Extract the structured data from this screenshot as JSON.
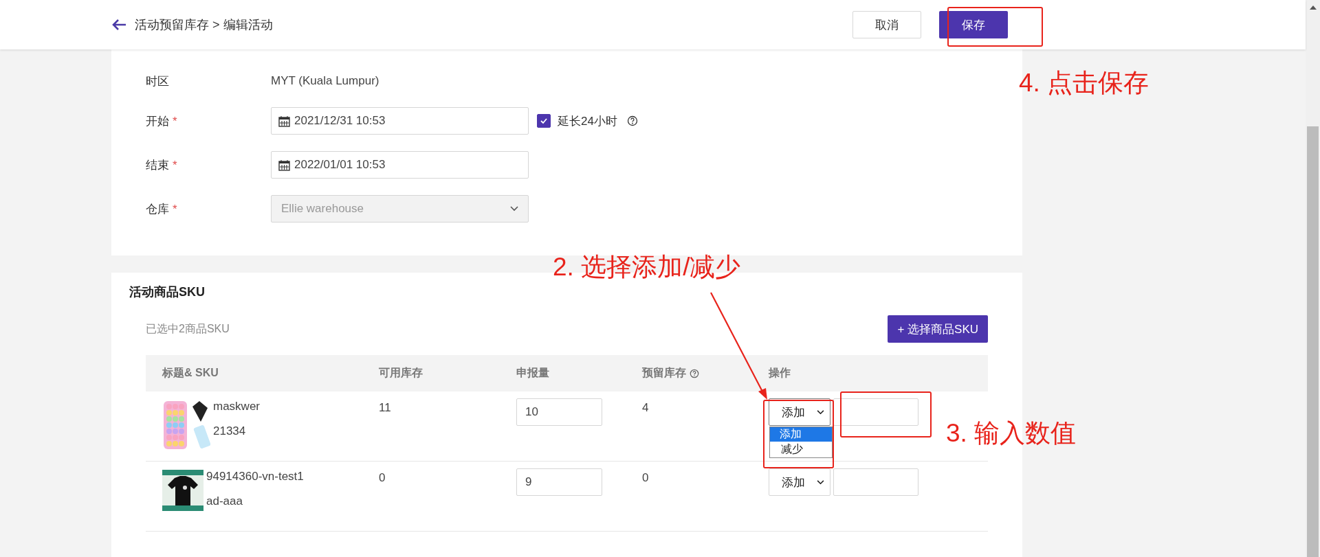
{
  "header": {
    "breadcrumb": "活动预留库存 > 编辑活动",
    "buttons": [
      {
        "label": "取消",
        "kind": "secondary"
      },
      {
        "label": "保存",
        "kind": "primary"
      }
    ]
  },
  "form": {
    "fields": [
      {
        "label": "时区",
        "kind": "text",
        "value": "MYT (Kuala Lumpur)"
      },
      {
        "label": "开始",
        "required_mark": "*",
        "kind": "date",
        "value": "2021/12/31 10:53",
        "checkbox": {
          "label": "延长24小时",
          "checked": true
        }
      },
      {
        "label": "结束",
        "required_mark": "*",
        "kind": "date",
        "value": "2022/01/01 10:53"
      },
      {
        "label": "仓库",
        "required_mark": "*",
        "kind": "select",
        "value": "Ellie warehouse",
        "disabled": true
      }
    ]
  },
  "sku_section": {
    "title": "活动商品SKU",
    "selected_count": "已选中2商品SKU",
    "add_button": "+ 选择商品SKU",
    "table": {
      "columns": [
        {
          "label": "标题& SKU"
        },
        {
          "label": "可用库存"
        },
        {
          "label": "申报量"
        },
        {
          "label": "预留库存",
          "help": true
        },
        {
          "label": "操作"
        }
      ],
      "rows": [
        {
          "title": "maskwer",
          "sku": "21334",
          "available": "11",
          "declared": "10",
          "reserved": "4",
          "operation": "添加",
          "dropdown": {
            "expanded": true,
            "options": [
              {
                "label": "添加",
                "selected": true
              },
              {
                "label": "减少",
                "selected": false
              }
            ]
          }
        },
        {
          "title": "94914360-vn-test1",
          "sku": "ad-aaa",
          "available": "0",
          "declared": "9",
          "reserved": "0",
          "operation": "添加",
          "dropdown": {
            "expanded": false
          }
        }
      ]
    }
  },
  "annotations": [
    {
      "kind": "box"
    },
    {
      "kind": "label",
      "text": "4. 点击保存"
    },
    {
      "kind": "label",
      "text": "2. 选择添加/减少"
    },
    {
      "kind": "box"
    },
    {
      "kind": "box"
    },
    {
      "kind": "label",
      "text": "3. 输入数值"
    },
    {
      "kind": "arrow"
    }
  ]
}
